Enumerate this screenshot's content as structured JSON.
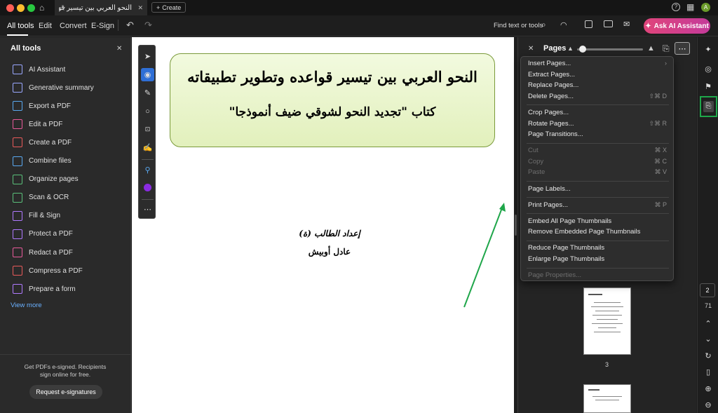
{
  "titlebar": {
    "tab_title": "النحو العربي بين تيسير قوا...",
    "create_label": "Create",
    "avatar_letter": "A"
  },
  "menubar": {
    "items": [
      "All tools",
      "Edit",
      "Convert",
      "E-Sign"
    ],
    "find_label": "Find text or tools",
    "ask_ai_label": "Ask AI Assistant"
  },
  "left_panel": {
    "title": "All tools",
    "tools": [
      {
        "label": "AI Assistant",
        "icon": "ai-assistant-icon",
        "color": "#9aa8ff"
      },
      {
        "label": "Generative summary",
        "icon": "summary-icon",
        "color": "#9aa8ff"
      },
      {
        "label": "Export a PDF",
        "icon": "export-pdf-icon",
        "color": "#5aa9f0"
      },
      {
        "label": "Edit a PDF",
        "icon": "edit-pdf-icon",
        "color": "#e85a9a"
      },
      {
        "label": "Create a PDF",
        "icon": "create-pdf-icon",
        "color": "#e85a5a"
      },
      {
        "label": "Combine files",
        "icon": "combine-icon",
        "color": "#5aa9f0"
      },
      {
        "label": "Organize pages",
        "icon": "organize-icon",
        "color": "#5ac07a"
      },
      {
        "label": "Scan & OCR",
        "icon": "scan-icon",
        "color": "#5ac07a"
      },
      {
        "label": "Fill & Sign",
        "icon": "fill-sign-icon",
        "color": "#b07aff"
      },
      {
        "label": "Protect a PDF",
        "icon": "protect-icon",
        "color": "#b07aff"
      },
      {
        "label": "Redact a PDF",
        "icon": "redact-icon",
        "color": "#e85a9a"
      },
      {
        "label": "Compress a PDF",
        "icon": "compress-icon",
        "color": "#e85a5a"
      },
      {
        "label": "Prepare a form",
        "icon": "form-icon",
        "color": "#b07aff"
      }
    ],
    "view_more": "View more",
    "promo_text": "Get PDFs e-signed. Recipients sign online for free.",
    "promo_button": "Request e-signatures"
  },
  "document": {
    "title_line1": "النحو العربي بين تيسير قواعده وتطوير تطبيقاته",
    "title_line2": "كتاب \"تجديد النحو لشوقي ضيف أنموذجا\"",
    "prepared_by": "إعداد الطالب (ة)",
    "author": "عادل أوبيش"
  },
  "pages_panel": {
    "title": "Pages",
    "thumb_label_3": "3"
  },
  "context_menu": {
    "groups": [
      [
        {
          "label": "Insert Pages...",
          "shortcut": "›",
          "disabled": false
        },
        {
          "label": "Extract Pages...",
          "shortcut": "",
          "disabled": false
        },
        {
          "label": "Replace Pages...",
          "shortcut": "",
          "disabled": false
        },
        {
          "label": "Delete Pages...",
          "shortcut": "⇧⌘ D",
          "disabled": false
        }
      ],
      [
        {
          "label": "Crop Pages...",
          "shortcut": "",
          "disabled": false
        },
        {
          "label": "Rotate Pages...",
          "shortcut": "⇧⌘ R",
          "disabled": false
        },
        {
          "label": "Page Transitions...",
          "shortcut": "",
          "disabled": false
        }
      ],
      [
        {
          "label": "Cut",
          "shortcut": "⌘ X",
          "disabled": true
        },
        {
          "label": "Copy",
          "shortcut": "⌘ C",
          "disabled": true
        },
        {
          "label": "Paste",
          "shortcut": "⌘ V",
          "disabled": true
        }
      ],
      [
        {
          "label": "Page Labels...",
          "shortcut": "",
          "disabled": false
        }
      ],
      [
        {
          "label": "Print Pages...",
          "shortcut": "⌘ P",
          "disabled": false
        }
      ],
      [
        {
          "label": "Embed All Page Thumbnails",
          "shortcut": "",
          "disabled": false
        },
        {
          "label": "Remove Embedded Page Thumbnails",
          "shortcut": "",
          "disabled": false
        }
      ],
      [
        {
          "label": "Reduce Page Thumbnails",
          "shortcut": "",
          "disabled": false
        },
        {
          "label": "Enlarge Page Thumbnails",
          "shortcut": "",
          "disabled": false
        }
      ],
      [
        {
          "label": "Page Properties...",
          "shortcut": "",
          "disabled": true
        }
      ]
    ]
  },
  "right_rail": {
    "current_page": "2",
    "total_pages": "71"
  },
  "colors": {
    "accent_green": "#1fa64a",
    "ask_ai_gradient_start": "#e0457b",
    "link_blue": "#6ab0ff"
  }
}
